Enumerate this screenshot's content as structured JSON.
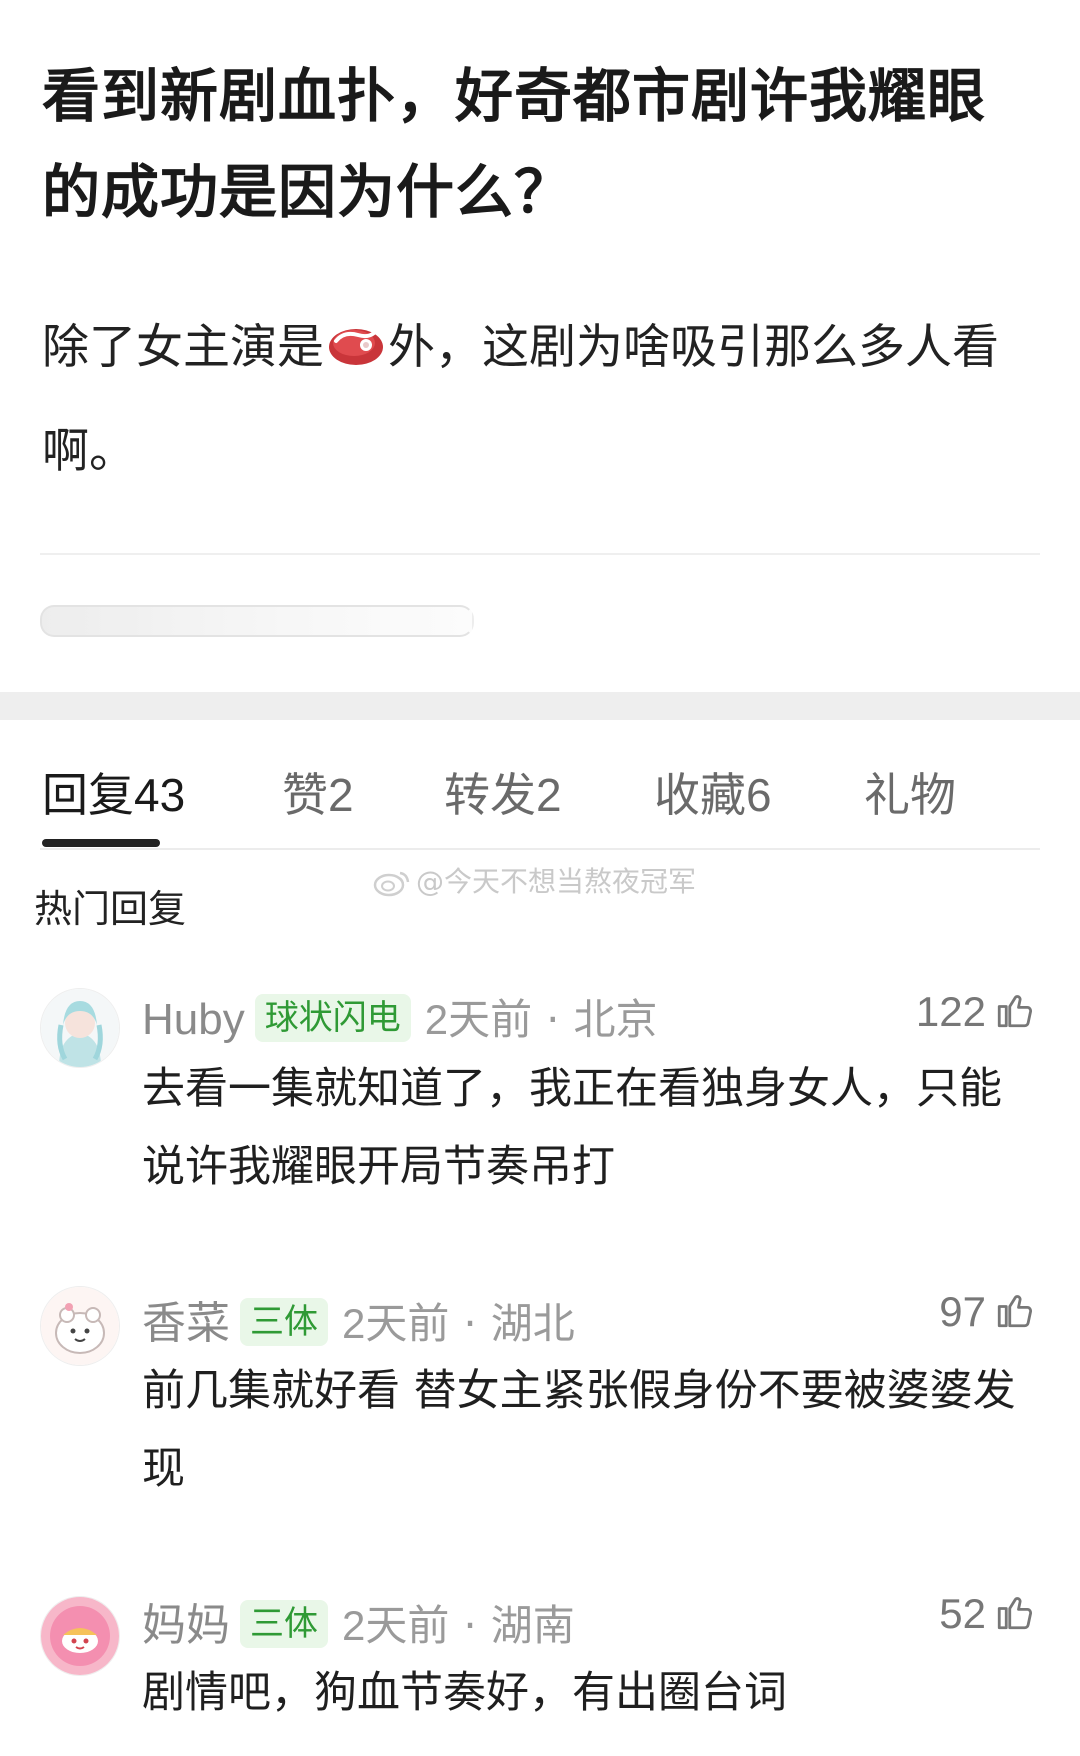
{
  "post": {
    "title": "看到新剧血扑，好奇都市剧许我耀眼的成功是因为什么？",
    "body_before_emoji": "除了女主演是",
    "emoji": "steak-emoji",
    "body_after_emoji": "外，这剧为啥吸引那么多人看啊。"
  },
  "tabs": [
    {
      "label": "回复",
      "count": "43",
      "active": true
    },
    {
      "label": "赞",
      "count": "2",
      "active": false
    },
    {
      "label": "转发",
      "count": "2",
      "active": false
    },
    {
      "label": "收藏",
      "count": "6",
      "active": false
    },
    {
      "label": "礼物",
      "count": "",
      "active": false
    }
  ],
  "section_label": "热门回复",
  "watermark": "@今天不想当熬夜冠军",
  "comments": [
    {
      "name": "Huby",
      "badge": "球状闪电",
      "time": "2天前",
      "dot": "·",
      "location": "北京",
      "likes": "122",
      "text": "去看一集就知道了，我正在看独身女人，只能说许我耀眼开局节奏吊打"
    },
    {
      "name": "香菜",
      "badge": "三体",
      "time": "2天前",
      "dot": "·",
      "location": "湖北",
      "likes": "97",
      "text": "前几集就好看 替女主紧张假身份不要被婆婆发现"
    },
    {
      "name": "妈妈",
      "badge": "三体",
      "time": "2天前",
      "dot": "·",
      "location": "湖南",
      "likes": "52",
      "text": "剧情吧，狗血节奏好，有出圈台词"
    }
  ],
  "colors": {
    "badge_bg": "#e9f7e8",
    "badge_text": "#2f9a35",
    "meta_gray": "#9a9a9a",
    "divider_band": "#eeeeee"
  }
}
